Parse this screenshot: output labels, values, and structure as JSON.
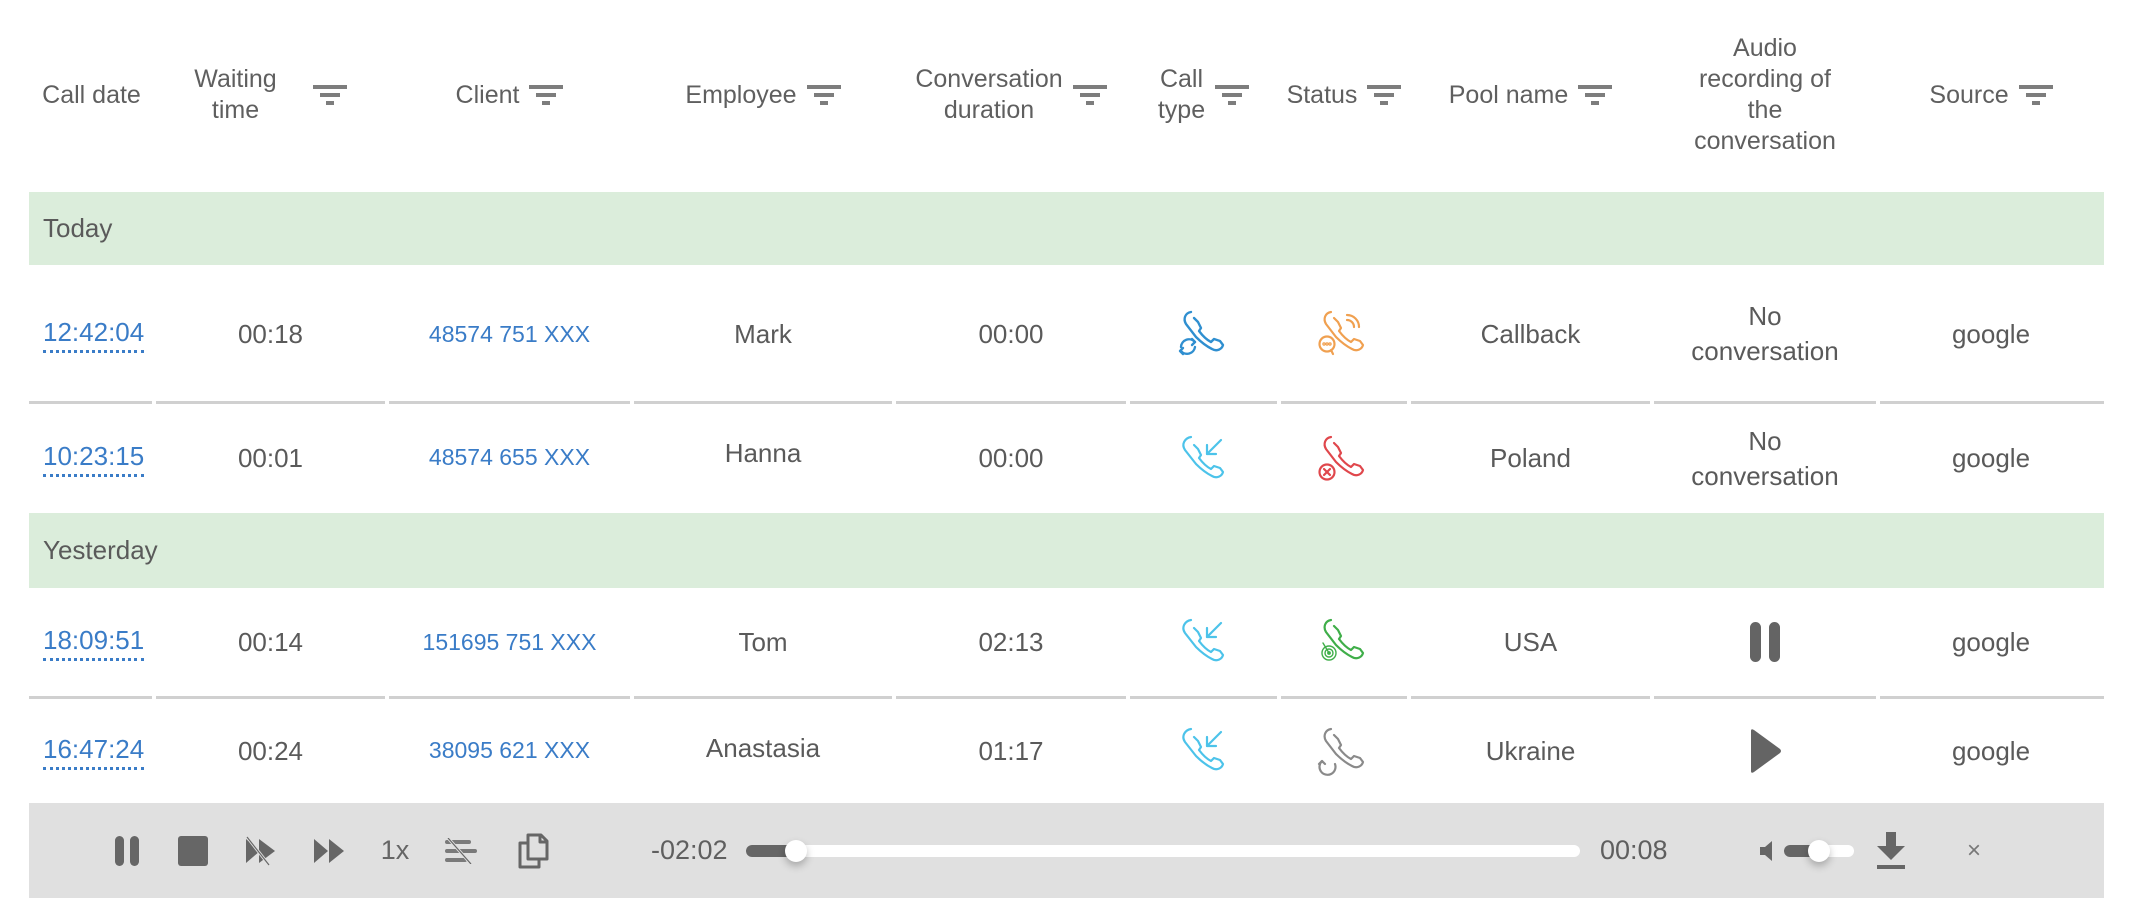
{
  "colors": {
    "group_bg": "#dbeddb",
    "link": "#3a7cc7",
    "player_bg": "#e0e0e0",
    "icon_blue": "#2f8fd0",
    "icon_cyan": "#4cc3ea",
    "icon_orange": "#f0a050",
    "icon_red": "#e0474c",
    "icon_green": "#3fae49",
    "icon_gray": "#8a8a8a"
  },
  "columns": [
    {
      "key": "call_date",
      "label": "Call date",
      "filter": false
    },
    {
      "key": "waiting_time",
      "label": "Waiting\ntime",
      "filter": true
    },
    {
      "key": "client",
      "label": "Client",
      "filter": true
    },
    {
      "key": "employee",
      "label": "Employee",
      "filter": true
    },
    {
      "key": "conversation_duration",
      "label": "Conversation\nduration",
      "filter": true
    },
    {
      "key": "call_type",
      "label": "Call\ntype",
      "filter": true
    },
    {
      "key": "status",
      "label": "Status",
      "filter": true
    },
    {
      "key": "pool_name",
      "label": "Pool name",
      "filter": true
    },
    {
      "key": "audio",
      "label": "Audio\nrecording of\nthe\nconversation",
      "filter": false
    },
    {
      "key": "source",
      "label": "Source",
      "filter": true
    }
  ],
  "groups": [
    {
      "label": "Today",
      "rows": [
        {
          "call_date": "12:42:04",
          "waiting_time": "00:18",
          "client": "48574 751 XXX",
          "employee": "Mark",
          "conversation_duration": "00:00",
          "call_type_icon": "callback-call-icon",
          "status_icon": "ringing-message-call-icon",
          "pool_name": "Callback",
          "audio": "No\nconversation",
          "audio_control": null,
          "source": "google"
        },
        {
          "call_date": "10:23:15",
          "waiting_time": "00:01",
          "client": "48574 655 XXX",
          "employee": "Hanna",
          "conversation_duration": "00:00",
          "call_type_icon": "incoming-call-icon",
          "status_icon": "missed-call-icon",
          "pool_name": "Poland",
          "audio": "No\nconversation",
          "audio_control": null,
          "source": "google"
        }
      ]
    },
    {
      "label": "Yesterday",
      "rows": [
        {
          "call_date": "18:09:51",
          "waiting_time": "00:14",
          "client": "151695 751 XXX",
          "employee": "Tom",
          "conversation_duration": "02:13",
          "call_type_icon": "incoming-call-icon",
          "status_icon": "target-answered-call-icon",
          "pool_name": "USA",
          "audio": "",
          "audio_control": "pause",
          "source": "google"
        },
        {
          "call_date": "16:47:24",
          "waiting_time": "00:24",
          "client": "38095 621 XXX",
          "employee": "Anastasia",
          "conversation_duration": "01:17",
          "call_type_icon": "incoming-call-icon",
          "status_icon": "redirect-call-icon",
          "pool_name": "Ukraine",
          "audio": "",
          "audio_control": "play",
          "source": "google"
        }
      ]
    }
  ],
  "player": {
    "speed_label": "1x",
    "remaining": "-02:02",
    "elapsed": "00:08",
    "progress_fraction": 0.06,
    "volume_fraction": 0.5,
    "buttons": [
      "pause",
      "stop",
      "skip-silence-off",
      "fast-forward",
      "speed",
      "text-off",
      "copy",
      "mute",
      "download",
      "close"
    ],
    "close_label": "×"
  }
}
